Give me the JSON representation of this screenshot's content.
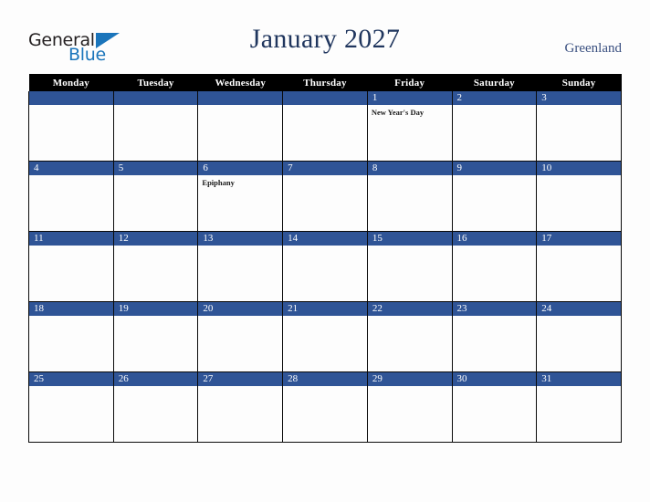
{
  "brand": {
    "name_part1": "General",
    "name_part2": "Blue",
    "triangle_icon": "triangle-icon",
    "color_dark": "#231f20",
    "color_blue": "#1b75bb"
  },
  "header": {
    "title": "January 2027",
    "country": "Greenland",
    "title_color": "#20365e",
    "country_color": "#3a5080"
  },
  "calendar": {
    "month": "January",
    "year": "2027",
    "accent_color": "#2f5496",
    "header_bg": "#000000",
    "weekdays": [
      "Monday",
      "Tuesday",
      "Wednesday",
      "Thursday",
      "Friday",
      "Saturday",
      "Sunday"
    ],
    "weeks": [
      [
        {
          "day": "",
          "events": []
        },
        {
          "day": "",
          "events": []
        },
        {
          "day": "",
          "events": []
        },
        {
          "day": "",
          "events": []
        },
        {
          "day": "1",
          "events": [
            "New Year's Day"
          ]
        },
        {
          "day": "2",
          "events": []
        },
        {
          "day": "3",
          "events": []
        }
      ],
      [
        {
          "day": "4",
          "events": []
        },
        {
          "day": "5",
          "events": []
        },
        {
          "day": "6",
          "events": [
            "Epiphany"
          ]
        },
        {
          "day": "7",
          "events": []
        },
        {
          "day": "8",
          "events": []
        },
        {
          "day": "9",
          "events": []
        },
        {
          "day": "10",
          "events": []
        }
      ],
      [
        {
          "day": "11",
          "events": []
        },
        {
          "day": "12",
          "events": []
        },
        {
          "day": "13",
          "events": []
        },
        {
          "day": "14",
          "events": []
        },
        {
          "day": "15",
          "events": []
        },
        {
          "day": "16",
          "events": []
        },
        {
          "day": "17",
          "events": []
        }
      ],
      [
        {
          "day": "18",
          "events": []
        },
        {
          "day": "19",
          "events": []
        },
        {
          "day": "20",
          "events": []
        },
        {
          "day": "21",
          "events": []
        },
        {
          "day": "22",
          "events": []
        },
        {
          "day": "23",
          "events": []
        },
        {
          "day": "24",
          "events": []
        }
      ],
      [
        {
          "day": "25",
          "events": []
        },
        {
          "day": "26",
          "events": []
        },
        {
          "day": "27",
          "events": []
        },
        {
          "day": "28",
          "events": []
        },
        {
          "day": "29",
          "events": []
        },
        {
          "day": "30",
          "events": []
        },
        {
          "day": "31",
          "events": []
        }
      ]
    ]
  }
}
